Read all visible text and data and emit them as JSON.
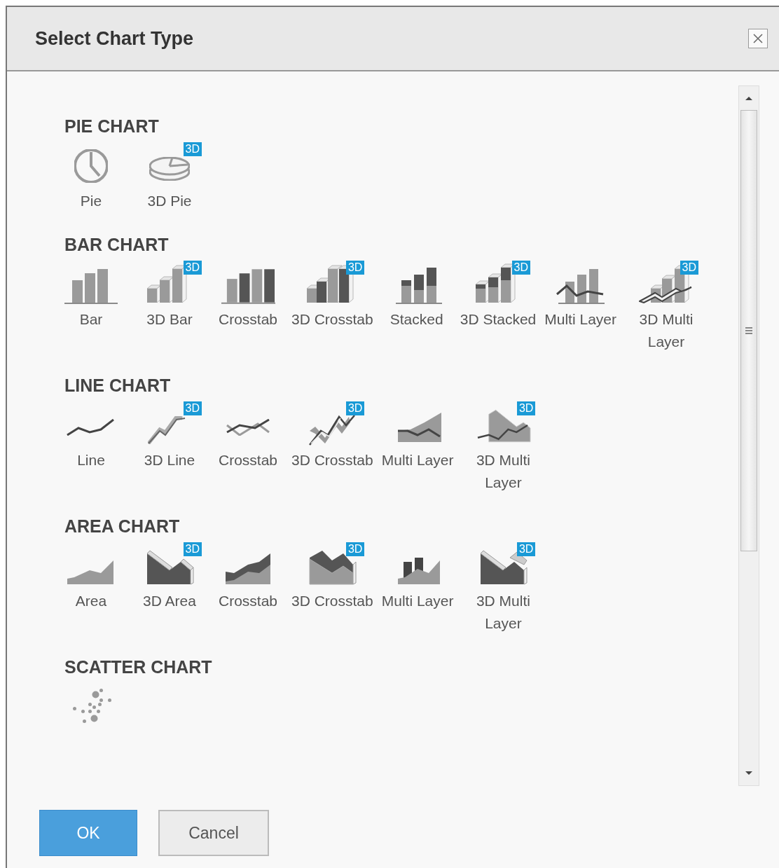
{
  "dialog": {
    "title": "Select Chart Type"
  },
  "sections": [
    {
      "heading": "PIE CHART",
      "items": [
        {
          "label": "Pie",
          "kind": "pie"
        },
        {
          "label": "3D Pie",
          "kind": "pie3d",
          "badge": "3D"
        }
      ]
    },
    {
      "heading": "BAR CHART",
      "items": [
        {
          "label": "Bar",
          "kind": "bar"
        },
        {
          "label": "3D Bar",
          "kind": "bar3d",
          "badge": "3D"
        },
        {
          "label": "Crosstab",
          "kind": "bar-crosstab"
        },
        {
          "label": "3D Crosstab",
          "kind": "bar-crosstab3d",
          "badge": "3D"
        },
        {
          "label": "Stacked",
          "kind": "bar-stacked"
        },
        {
          "label": "3D Stacked",
          "kind": "bar-stacked3d",
          "badge": "3D"
        },
        {
          "label": "Multi Layer",
          "kind": "bar-multilayer"
        },
        {
          "label": "3D Multi Layer",
          "kind": "bar-multilayer3d",
          "badge": "3D"
        }
      ]
    },
    {
      "heading": "LINE CHART",
      "items": [
        {
          "label": "Line",
          "kind": "line"
        },
        {
          "label": "3D Line",
          "kind": "line3d",
          "badge": "3D"
        },
        {
          "label": "Crosstab",
          "kind": "line-crosstab"
        },
        {
          "label": "3D Crosstab",
          "kind": "line-crosstab3d",
          "badge": "3D"
        },
        {
          "label": "Multi Layer",
          "kind": "line-multilayer"
        },
        {
          "label": "3D Multi Layer",
          "kind": "line-multilayer3d",
          "badge": "3D"
        }
      ]
    },
    {
      "heading": "AREA CHART",
      "items": [
        {
          "label": "Area",
          "kind": "area"
        },
        {
          "label": "3D Area",
          "kind": "area3d",
          "badge": "3D"
        },
        {
          "label": "Crosstab",
          "kind": "area-crosstab"
        },
        {
          "label": "3D Crosstab",
          "kind": "area-crosstab3d",
          "badge": "3D"
        },
        {
          "label": "Multi Layer",
          "kind": "area-multilayer"
        },
        {
          "label": "3D Multi Layer",
          "kind": "area-multilayer3d",
          "badge": "3D"
        }
      ]
    },
    {
      "heading": "SCATTER CHART",
      "items": [
        {
          "kind": "scatter"
        }
      ]
    }
  ],
  "buttons": [
    {
      "label": "OK",
      "kind": "primary"
    },
    {
      "label": "Cancel",
      "kind": "secondary"
    }
  ]
}
